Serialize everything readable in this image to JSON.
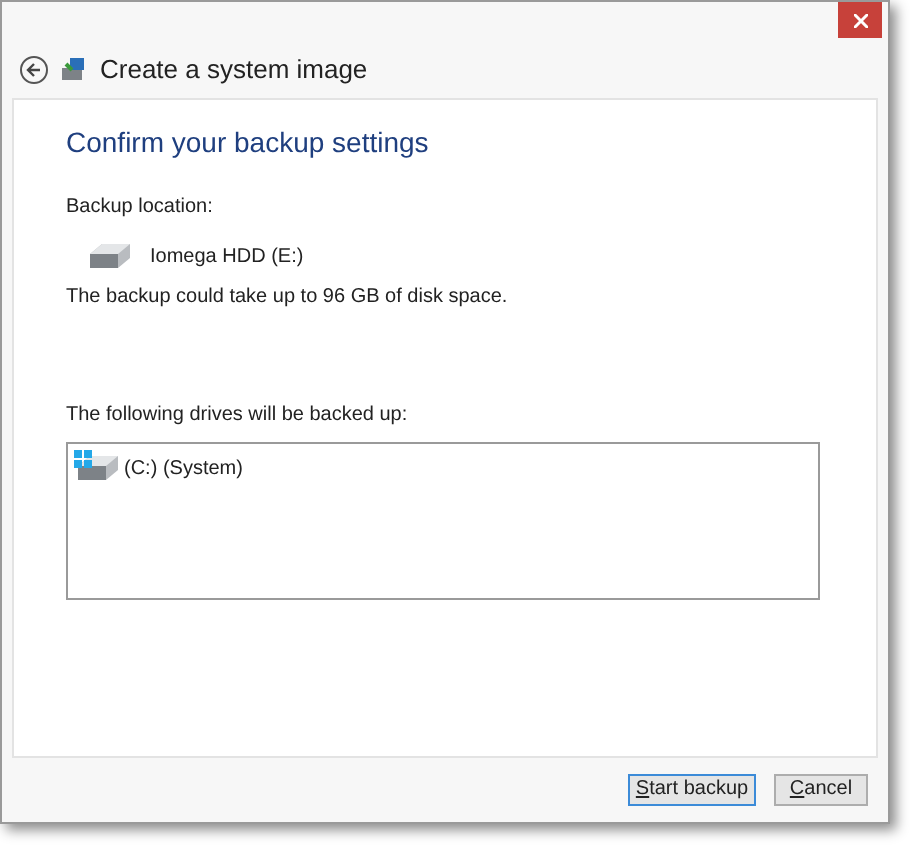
{
  "window": {
    "title": "Create a system image"
  },
  "heading": "Confirm your backup settings",
  "location_label": "Backup location:",
  "location": "Iomega HDD (E:)",
  "space_note": "The backup could take up to 96 GB of disk space.",
  "drives_label": "The following drives will be backed up:",
  "drives": [
    "(C:) (System)"
  ],
  "buttons": [
    {
      "label": "Start backup",
      "default": true
    },
    {
      "label": "Cancel",
      "default": false
    }
  ]
}
